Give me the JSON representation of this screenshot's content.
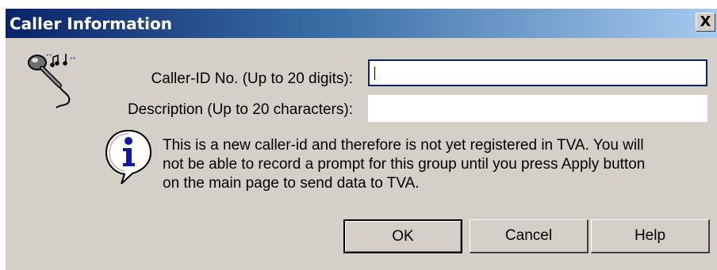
{
  "window": {
    "title": "Caller Information",
    "close_label": "X"
  },
  "form": {
    "caller_id_label": "Caller-ID No. (Up to 20 digits):",
    "caller_id_value": "",
    "description_label": "Description (Up to 20 characters):",
    "description_value": ""
  },
  "info": {
    "icon": "info-icon",
    "lines": [
      "This is a new caller-id and therefore is not yet registered in TVA. You will",
      "not be able to record a prompt for this group until you press Apply button",
      "on the main page to send data to TVA."
    ]
  },
  "buttons": {
    "ok": "OK",
    "cancel": "Cancel",
    "help": "Help"
  },
  "colors": {
    "title_gradient_start": "#0a246a",
    "title_gradient_end": "#a6caf0",
    "dialog_face": "#d4d0c8",
    "info_blue": "#1018a8"
  }
}
